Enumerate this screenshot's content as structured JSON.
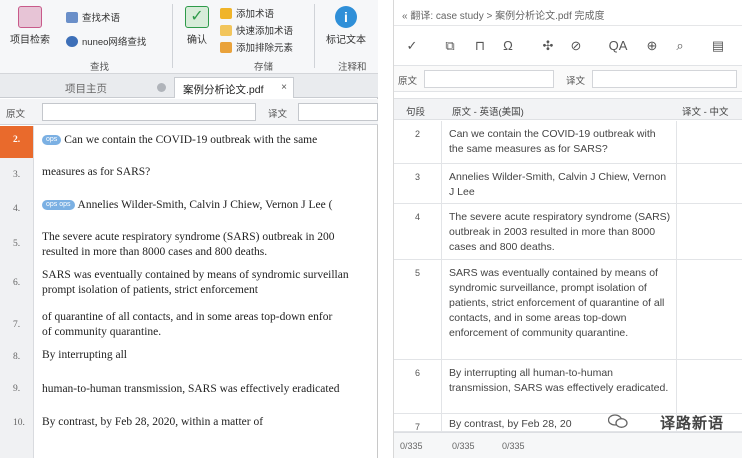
{
  "ribbon": {
    "big_buttons": [
      {
        "label": "项目检索",
        "icon": "search-doc-icon",
        "color": "#c85a8a"
      },
      {
        "label": "确认",
        "icon": "check-icon",
        "color": "#2e9a4a"
      },
      {
        "label": "标记文本",
        "icon": "info-icon",
        "color": "#2f8fd8"
      }
    ],
    "small_buttons": [
      {
        "label": "查找术语",
        "icon": "term-search-icon"
      },
      {
        "label": "nuneo网络查找",
        "icon": "web-search-icon"
      },
      {
        "label": "添加术语",
        "icon": "add-term-icon"
      },
      {
        "label": "快速添加术语",
        "icon": "quick-add-term-icon"
      },
      {
        "label": "添加排除元素",
        "icon": "add-exclude-icon"
      }
    ],
    "groups": [
      "查找",
      "存储",
      "注释和"
    ]
  },
  "tabs": [
    {
      "label": "项目主页"
    },
    {
      "label": "案例分析论文.pdf"
    }
  ],
  "search": {
    "source_label": "原文",
    "target_label": "译文"
  },
  "left_rows": [
    {
      "num": "2.",
      "text": "Can we contain the COVID-19 outbreak with the same",
      "tag": "ops",
      "selected": true
    },
    {
      "num": "3.",
      "text": "measures as for SARS?"
    },
    {
      "num": "4.",
      "text": "Annelies Wilder-Smith, Calvin J Chiew, Vernon J Lee (",
      "tag2": "ops  ops"
    },
    {
      "num": "5.",
      "text": "The severe acute respiratory syndrome (SARS) outbreak in 200",
      "text2": "resulted in more than 8000 cases and 800 deaths."
    },
    {
      "num": "6.",
      "text": "SARS was eventually contained by means of syndromic surveillan",
      "text2": "prompt isolation of patients, strict enforcement"
    },
    {
      "num": "7.",
      "text": "of quarantine of all contacts, and in some areas top-down enfor",
      "text2": "of community quarantine."
    },
    {
      "num": "8.",
      "text": "By interrupting all"
    },
    {
      "num": "9.",
      "text": "human-to-human transmission, SARS was effectively eradicated"
    },
    {
      "num": "10.",
      "text": "By contrast, by Feb 28, 2020, within a matter of"
    }
  ],
  "right": {
    "title": "«  翻译:  case study > 案例分析论文.pdf      完成度",
    "filter": {
      "source_label": "原文",
      "target_label": "译文"
    },
    "header": {
      "num": "句段",
      "source": "原文 - 英语(美国)",
      "target": "译文 - 中文"
    },
    "rows": [
      {
        "num": "2",
        "text": "Can we contain the COVID-19 outbreak with the same measures as for SARS?"
      },
      {
        "num": "3",
        "text": "Annelies Wilder-Smith, Calvin J Chiew, Vernon J Lee"
      },
      {
        "num": "4",
        "text": "The severe acute respiratory syndrome (SARS) outbreak in 2003 resulted in more than 8000 cases and 800 deaths."
      },
      {
        "num": "5",
        "text": "SARS was eventually contained by means of syndromic surveillance, prompt isolation of patients, strict enforcement of quarantine of all contacts, and in some areas top-down enforcement of community quarantine."
      },
      {
        "num": "6",
        "text": "By interrupting all human-to-human transmission, SARS was effectively eradicated."
      },
      {
        "num": "7",
        "text": "By contrast, by Feb 28, 20"
      }
    ],
    "status": [
      "0/335",
      "0/335",
      "0/335"
    ]
  },
  "watermark": "译路新语"
}
